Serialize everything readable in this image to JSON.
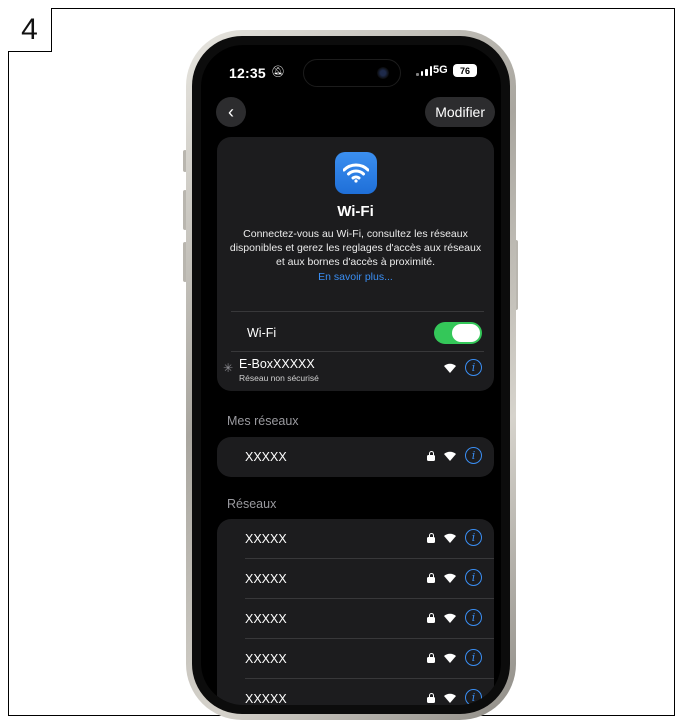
{
  "step_number": "4",
  "status_bar": {
    "time": "12:35",
    "network": "5G",
    "battery": "76"
  },
  "nav": {
    "back_label": "‹",
    "edit_label": "Modifier"
  },
  "wifi_card": {
    "title": "Wi-Fi",
    "description": "Connectez-vous au Wi-Fi, consultez les réseaux disponibles et gerez les reglages d'accès aux réseaux et aux bornes d'accès à proximité.",
    "learn_more": "En savoir plus...",
    "toggle_label": "Wi-Fi",
    "toggle_on": true,
    "connecting_network": {
      "name": "E-BoxXXXXX",
      "subtitle": "Réseau non sécurisé"
    }
  },
  "my_networks": {
    "header": "Mes réseaux",
    "items": [
      {
        "name": "XXXXX"
      }
    ]
  },
  "networks": {
    "header": "Réseaux",
    "items": [
      {
        "name": "XXXXX"
      },
      {
        "name": "XXXXX"
      },
      {
        "name": "XXXXX"
      },
      {
        "name": "XXXXX"
      },
      {
        "name": "XXXXX"
      }
    ]
  },
  "colors": {
    "accent": "#3a8ef3",
    "toggle_on": "#34c759",
    "card_bg": "#1c1c1e"
  },
  "icons": {
    "wifi": "wifi-icon",
    "lock": "lock-icon",
    "info": "info-icon"
  }
}
